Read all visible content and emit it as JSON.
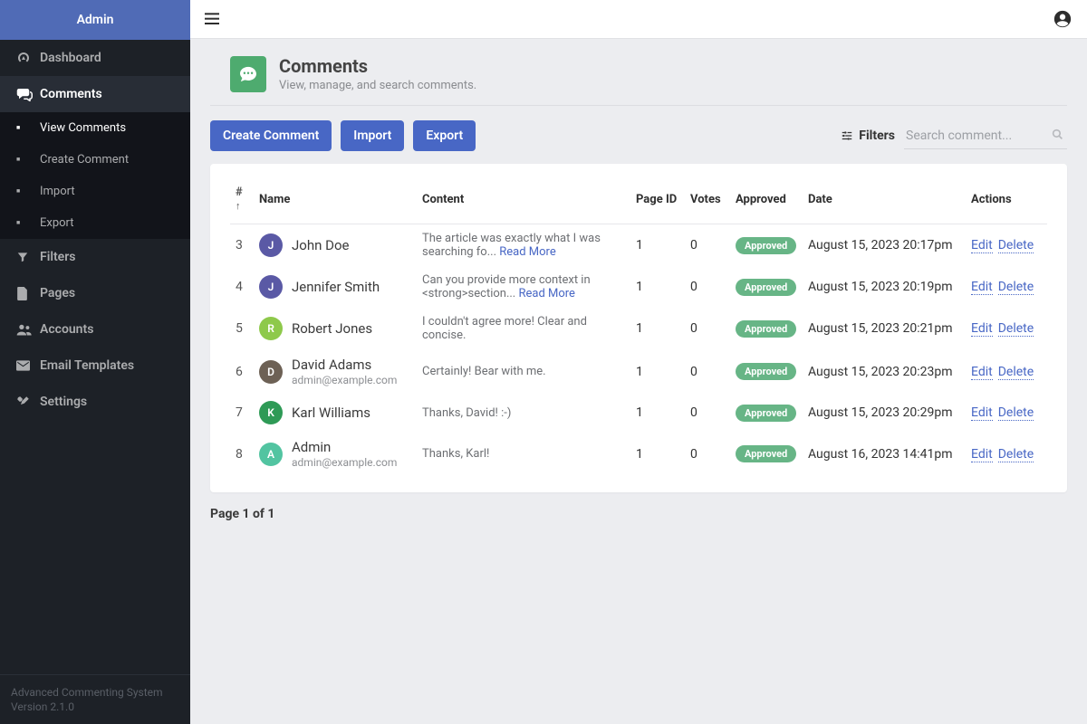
{
  "sidebar": {
    "brand": "Admin",
    "items": [
      {
        "label": "Dashboard"
      },
      {
        "label": "Comments",
        "active": true
      },
      {
        "label": "Filters"
      },
      {
        "label": "Pages"
      },
      {
        "label": "Accounts"
      },
      {
        "label": "Email Templates"
      },
      {
        "label": "Settings"
      }
    ],
    "comments_sub": [
      {
        "label": "View Comments",
        "active": true
      },
      {
        "label": "Create Comment"
      },
      {
        "label": "Import"
      },
      {
        "label": "Export"
      }
    ],
    "footer_line1": "Advanced Commenting System",
    "footer_line2": "Version 2.1.0"
  },
  "header": {
    "title": "Comments",
    "subtitle": "View, manage, and search comments."
  },
  "toolbar": {
    "create": "Create Comment",
    "import": "Import",
    "export": "Export",
    "filters": "Filters",
    "search_placeholder": "Search comment..."
  },
  "table": {
    "columns": {
      "num": "#",
      "name": "Name",
      "content": "Content",
      "page_id": "Page ID",
      "votes": "Votes",
      "approved": "Approved",
      "date": "Date",
      "actions": "Actions"
    },
    "read_more": "Read More",
    "approved_label": "Approved",
    "edit": "Edit",
    "delete": "Delete",
    "rows": [
      {
        "num": "3",
        "avatar_letter": "J",
        "avatar_color": "#5a59a5",
        "name": "John Doe",
        "email": "",
        "content": "The article was exactly what I was searching fo...",
        "has_read_more": true,
        "page_id": "1",
        "votes": "0",
        "date": "August 15, 2023 20:17pm"
      },
      {
        "num": "4",
        "avatar_letter": "J",
        "avatar_color": "#5a59a5",
        "name": "Jennifer Smith",
        "email": "",
        "content": "Can you provide more context in <strong>section...",
        "has_read_more": true,
        "page_id": "1",
        "votes": "0",
        "date": "August 15, 2023 20:19pm"
      },
      {
        "num": "5",
        "avatar_letter": "R",
        "avatar_color": "#8ec94b",
        "name": "Robert Jones",
        "email": "",
        "content": "I couldn't agree more! Clear and concise.",
        "has_read_more": false,
        "page_id": "1",
        "votes": "0",
        "date": "August 15, 2023 20:21pm"
      },
      {
        "num": "6",
        "avatar_letter": "D",
        "avatar_color": "#6d6155",
        "name": "David Adams",
        "email": "admin@example.com",
        "content": "Certainly! Bear with me.",
        "has_read_more": false,
        "page_id": "1",
        "votes": "0",
        "date": "August 15, 2023 20:23pm"
      },
      {
        "num": "7",
        "avatar_letter": "K",
        "avatar_color": "#2e9a56",
        "name": "Karl Williams",
        "email": "",
        "content": "Thanks, David! :-)",
        "has_read_more": false,
        "page_id": "1",
        "votes": "0",
        "date": "August 15, 2023 20:29pm"
      },
      {
        "num": "8",
        "avatar_letter": "A",
        "avatar_color": "#52c4a1",
        "name": "Admin",
        "email": "admin@example.com",
        "content": "Thanks, Karl!",
        "has_read_more": false,
        "page_id": "1",
        "votes": "0",
        "date": "August 16, 2023 14:41pm"
      }
    ]
  },
  "pager": "Page 1 of 1"
}
